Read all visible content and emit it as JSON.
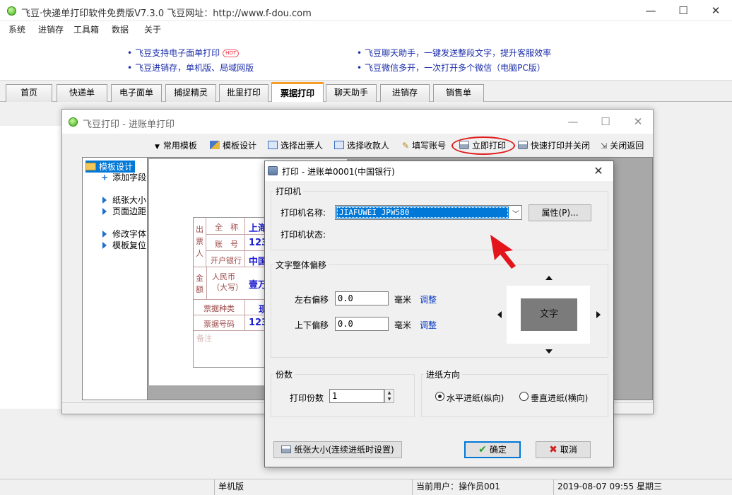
{
  "main_window": {
    "title": "飞豆·快递单打印软件免费版V7.3.0   飞豆网址：http://www.f-dou.com",
    "controls": {
      "minimize": "—",
      "maximize": "☐",
      "close": "✕"
    }
  },
  "menu": [
    "系统",
    "进销存",
    "工具箱",
    "数据",
    "关于"
  ],
  "banner": {
    "links": [
      {
        "text": "飞豆支持电子面单打印",
        "badge": "HOT"
      },
      {
        "text": "飞豆进销存，单机版、局域网版"
      },
      {
        "text": "飞豆聊天助手，一键发送整段文字，提升客服效率"
      },
      {
        "text": "飞豆微信多开，一次打开多个微信（电脑PC版）"
      }
    ],
    "bullet": "•"
  },
  "tabs": [
    {
      "label": "首页"
    },
    {
      "label": "快递单"
    },
    {
      "label": "电子面单"
    },
    {
      "label": "捕捉精灵"
    },
    {
      "label": "批里打印"
    },
    {
      "label": "票据打印",
      "active": true
    },
    {
      "label": "聊天助手"
    },
    {
      "label": "进销存"
    },
    {
      "label": "销售单"
    }
  ],
  "invoice_window": {
    "title": "飞豆打印 - 进账单打印",
    "controls": {
      "minimize": "—",
      "maximize": "☐",
      "close": "✕"
    },
    "toolbar": [
      {
        "label": "常用模板",
        "icon": "dropdown-triangle-icon"
      },
      {
        "label": "模板设计",
        "icon": "design-icon"
      },
      {
        "label": "选择出票人",
        "icon": "card-icon"
      },
      {
        "label": "选择收款人",
        "icon": "card-icon"
      },
      {
        "label": "填写账号",
        "icon": "pencil-icon"
      },
      {
        "label": "立即打印",
        "icon": "printer-icon"
      },
      {
        "label": "快速打印并关闭",
        "icon": "printer-icon"
      },
      {
        "label": "关闭返回",
        "icon": "exit-icon"
      }
    ],
    "tree": {
      "root": "模板设计",
      "items": [
        "添加字段",
        "纸张大小",
        "页面边距",
        "修改字体",
        "模板复位"
      ]
    },
    "preview": {
      "side_label": "出票人",
      "labels": [
        "全　称",
        "账　号",
        "开户银行",
        "金额",
        "人民币（大写）",
        "票据种类",
        "票据号码",
        "备注"
      ],
      "values": [
        "上海",
        "123",
        "中国",
        "壹万元",
        "现",
        "123"
      ]
    }
  },
  "print_dialog": {
    "title": "打印 - 进账单0001(中国银行)",
    "close": "✕",
    "printer_group": "打印机",
    "printer_name_label": "打印机名称:",
    "printer_name_value": "JIAFUWEI JPW580",
    "properties_button": "属性(P)...",
    "printer_status_label": "打印机状态:",
    "offset_group": "文字整体偏移",
    "h_offset_label": "左右偏移",
    "h_offset_value": "0.0",
    "v_offset_label": "上下偏移",
    "v_offset_value": "0.0",
    "unit": "毫米",
    "adjust_link": "调整",
    "preview_text": "文字",
    "copies_group": "份数",
    "copies_label": "打印份数",
    "copies_value": "1",
    "feed_group": "进纸方向",
    "feed_options": [
      {
        "label": "水平进纸(纵向)",
        "selected": true
      },
      {
        "label": "垂直进纸(横向)",
        "selected": false
      }
    ],
    "paper_button": "纸张大小(连续进纸时设置)",
    "ok_button": "确定",
    "cancel_button": "取消",
    "ok_icon_color": "#2a9d2a",
    "cancel_icon_color": "#d21f1f"
  },
  "statusbar": {
    "mode": "单机版",
    "user": "当前用户：操作员001",
    "datetime": "2019-08-07 09:55 星期三"
  },
  "colors": {
    "annotation_red": "#e01b1b",
    "link_blue": "#1c2ea8",
    "active_tab_accent": "#f59d27",
    "selection_blue": "#0078d7"
  }
}
